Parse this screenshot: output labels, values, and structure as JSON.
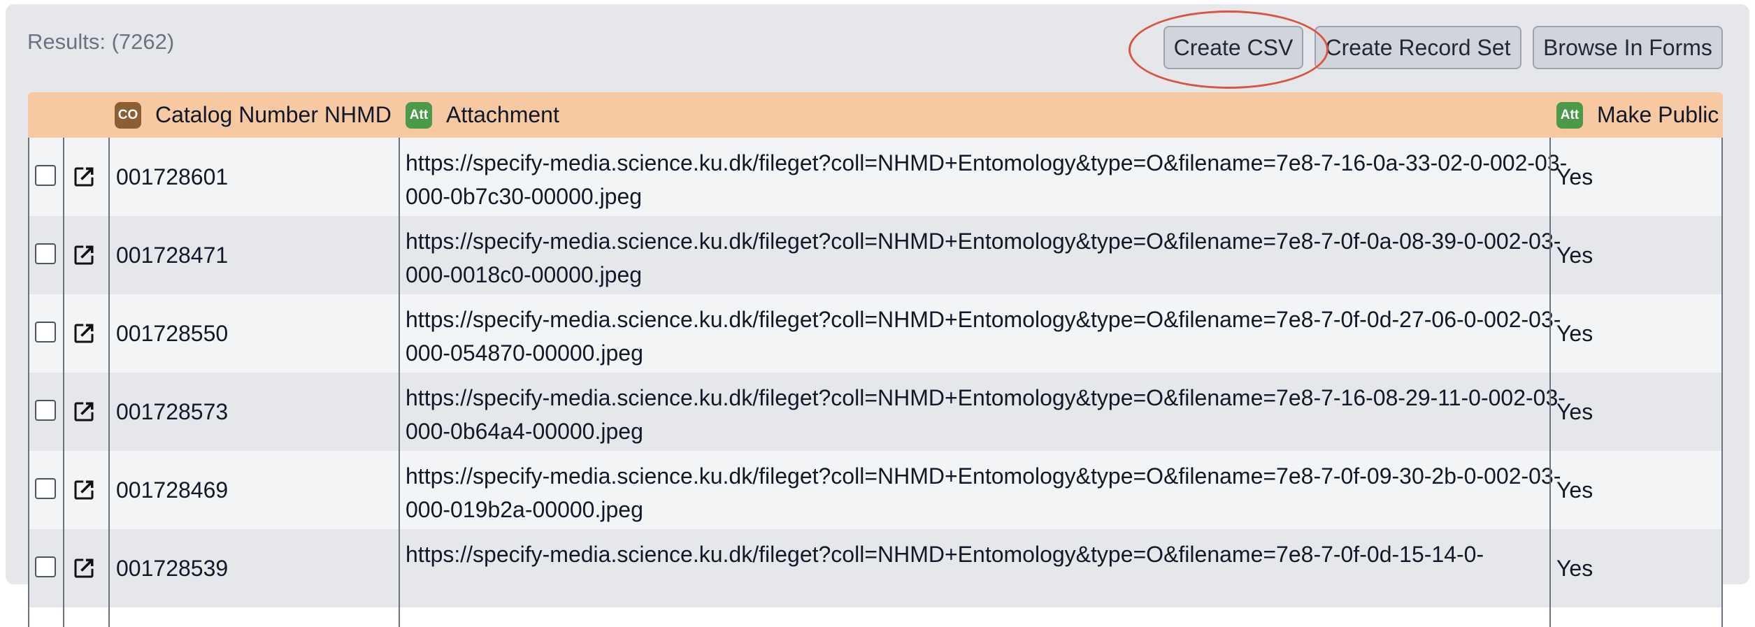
{
  "results": {
    "label": "Results: (7262)"
  },
  "toolbar": {
    "create_csv": "Create CSV",
    "create_record_set": "Create Record Set",
    "browse_in_forms": "Browse In Forms"
  },
  "columns": [
    {
      "badge": "CO",
      "badge_color": "#8b5e34",
      "label": "Catalog Number NHMD"
    },
    {
      "badge": "Att",
      "badge_color": "#4a9a4a",
      "label": "Attachment"
    },
    {
      "badge": "Att",
      "badge_color": "#4a9a4a",
      "label": "Make Public"
    }
  ],
  "rows": [
    {
      "catalog": "001728601",
      "url": "https://specify-media.science.ku.dk/fileget?coll=NHMD+Entomology&type=O&filename=7e8-7-16-0a-33-02-0-002-03-000-0b7c30-00000.jpeg",
      "public": "Yes"
    },
    {
      "catalog": "001728471",
      "url": "https://specify-media.science.ku.dk/fileget?coll=NHMD+Entomology&type=O&filename=7e8-7-0f-0a-08-39-0-002-03-000-0018c0-00000.jpeg",
      "public": "Yes"
    },
    {
      "catalog": "001728550",
      "url": "https://specify-media.science.ku.dk/fileget?coll=NHMD+Entomology&type=O&filename=7e8-7-0f-0d-27-06-0-002-03-000-054870-00000.jpeg",
      "public": "Yes"
    },
    {
      "catalog": "001728573",
      "url": "https://specify-media.science.ku.dk/fileget?coll=NHMD+Entomology&type=O&filename=7e8-7-16-08-29-11-0-002-03-000-0b64a4-00000.jpeg",
      "public": "Yes"
    },
    {
      "catalog": "001728469",
      "url": "https://specify-media.science.ku.dk/fileget?coll=NHMD+Entomology&type=O&filename=7e8-7-0f-09-30-2b-0-002-03-000-019b2a-00000.jpeg",
      "public": "Yes"
    },
    {
      "catalog": "001728539",
      "url": "https://specify-media.science.ku.dk/fileget?coll=NHMD+Entomology&type=O&filename=7e8-7-0f-0d-15-14-0-",
      "public": "Yes"
    }
  ]
}
